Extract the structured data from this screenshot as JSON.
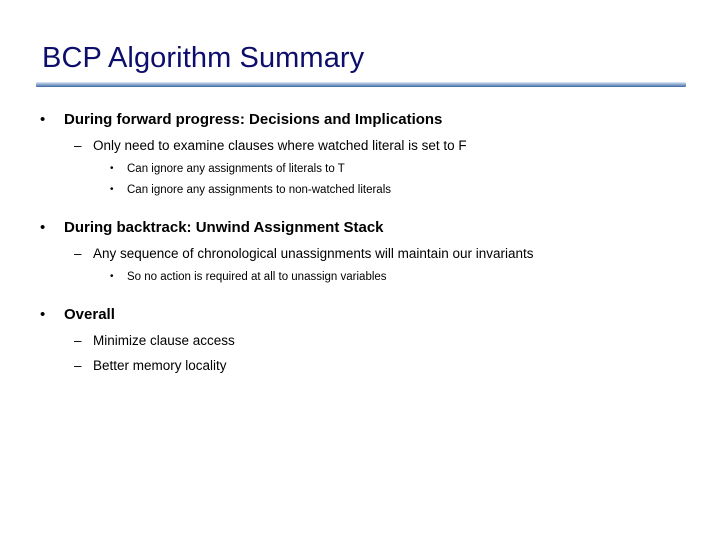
{
  "slide": {
    "title": "BCP Algorithm Summary",
    "title_color": "#0d0d6b",
    "rule_color": "#5b7fb4",
    "background_color": "#ffffff",
    "bullet_glyphs": {
      "level1": "•",
      "level2": "–",
      "level3": "•"
    },
    "sections": [
      {
        "heading": "During forward progress: Decisions and Implications",
        "sub": [
          {
            "text": "Only need to examine clauses where watched literal is set to F",
            "sub": [
              "Can ignore any assignments of literals to T",
              "Can ignore any assignments to non-watched literals"
            ]
          }
        ]
      },
      {
        "heading": "During backtrack: Unwind Assignment Stack",
        "sub": [
          {
            "text": "Any sequence of chronological unassignments will maintain our invariants",
            "sub": [
              "So no action is required at all to unassign variables"
            ]
          }
        ]
      },
      {
        "heading": "Overall",
        "sub": [
          {
            "text": "Minimize clause access",
            "sub": []
          },
          {
            "text": "Better memory locality",
            "sub": []
          }
        ]
      }
    ]
  }
}
